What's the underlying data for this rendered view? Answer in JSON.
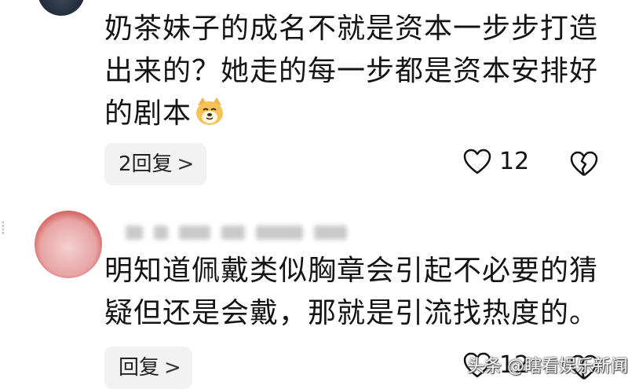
{
  "comments": [
    {
      "text_lines": [
        "奶茶妹子的成名不就是资本一步步打造",
        "出来的？她走的每一步都是资本安排好",
        "的剧本"
      ],
      "emoji": "dog-face-icon",
      "reply_label": "2回复",
      "like_count": "12"
    },
    {
      "text_lines": [
        "明知道佩戴类似胸章会引起不必要的猜",
        "疑但还是会戴，那就是引流找热度的。"
      ],
      "reply_label": "回复",
      "like_count": "12"
    }
  ],
  "watermark": "头条 @瞎看娱乐新闻",
  "colors": {
    "background": "#ffffff",
    "text": "#141414",
    "reply_bg": "#f2f2f2"
  }
}
